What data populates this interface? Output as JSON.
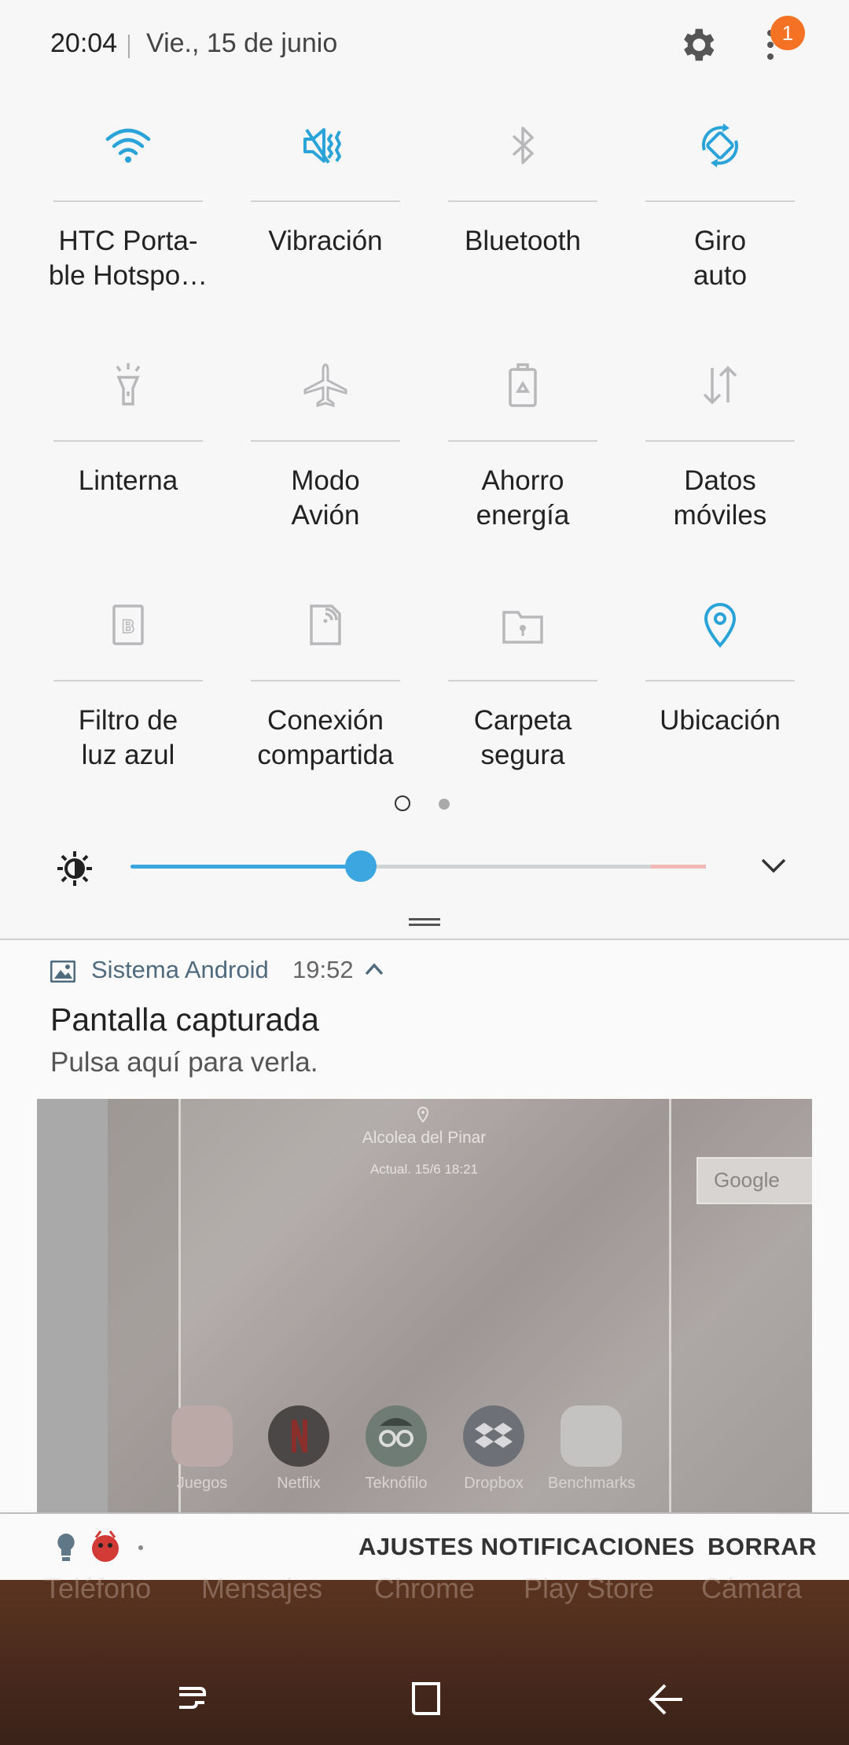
{
  "status": {
    "time": "20:04",
    "date": "Vie., 15 de junio",
    "icons": [
      "gear-icon",
      "more-vert-icon"
    ],
    "badge_count": "1",
    "badge_color": "#f57224"
  },
  "tiles": [
    {
      "label": "HTC Porta-\nble Hotspo…",
      "icon": "wifi-icon",
      "active": true
    },
    {
      "label": "Vibración",
      "icon": "vibrate-icon",
      "active": true
    },
    {
      "label": "Bluetooth",
      "icon": "bluetooth-icon",
      "active": false
    },
    {
      "label": "Giro\nauto",
      "icon": "auto-rotate-icon",
      "active": true
    },
    {
      "label": "Linterna",
      "icon": "flashlight-icon",
      "active": false
    },
    {
      "label": "Modo\nAvión",
      "icon": "airplane-icon",
      "active": false
    },
    {
      "label": "Ahorro\nenergía",
      "icon": "power-saving-icon",
      "active": false
    },
    {
      "label": "Datos\nmóviles",
      "icon": "mobile-data-icon",
      "active": false
    },
    {
      "label": "Filtro de\nluz azul",
      "icon": "blue-light-filter-icon",
      "active": false
    },
    {
      "label": "Conexión\ncompartida",
      "icon": "hotspot-icon",
      "active": false
    },
    {
      "label": "Carpeta\nsegura",
      "icon": "secure-folder-icon",
      "active": false
    },
    {
      "label": "Ubicación",
      "icon": "location-icon",
      "active": true
    }
  ],
  "colors": {
    "active": "#2aa3d8",
    "inactive": "#b8b8bb",
    "slider": "#3ba6e0"
  },
  "pager": {
    "pages": 2,
    "current": 1
  },
  "brightness": {
    "level": 0.4
  },
  "notification": {
    "app": "Sistema Android",
    "time": "19:52",
    "title": "Pantalla capturada",
    "text": "Pulsa aquí para verla.",
    "preview": {
      "city": "Alcolea del Pinar",
      "updated": "Actual. 15/6 18:21",
      "search": "Google",
      "apps": [
        "Juegos",
        "Netflix",
        "Teknófilo",
        "Dropbox",
        "Benchmarks"
      ]
    }
  },
  "footer": {
    "settings_label": "AJUSTES NOTIFICACIONES",
    "clear_label": "BORRAR"
  },
  "dock": [
    "Teléfono",
    "Mensajes",
    "Chrome",
    "Play Store",
    "Cámara"
  ]
}
